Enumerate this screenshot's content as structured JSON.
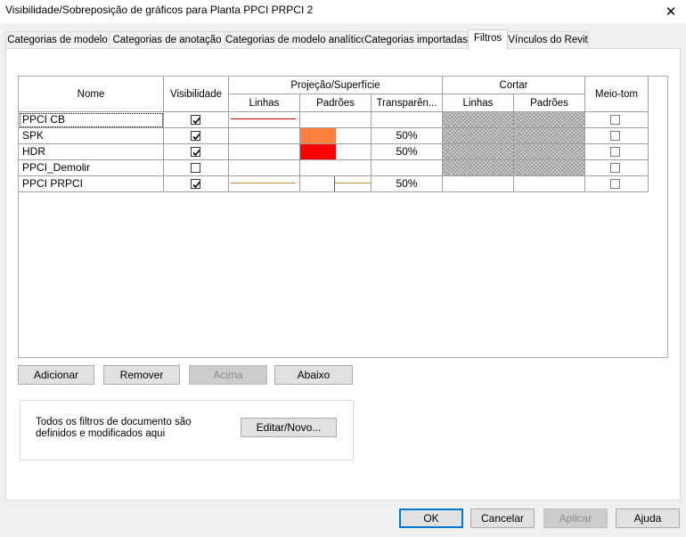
{
  "window": {
    "title": "Visibilidade/Sobreposição de gráficos para Planta PPCI PRPCI 2",
    "close_glyph": "✕"
  },
  "tabs": [
    {
      "label": "Categorias de modelo"
    },
    {
      "label": "Categorias de anotação"
    },
    {
      "label": "Categorias de modelo analítico"
    },
    {
      "label": "Categorias importadas"
    },
    {
      "label": "Filtros",
      "active": true
    },
    {
      "label": "Vínculos do Revit"
    }
  ],
  "table": {
    "headers": {
      "nome": "Nome",
      "visibilidade": "Visibilidade",
      "projecao_group": "Projeção/Superfície",
      "proj_linhas": "Linhas",
      "proj_padroes": "Padrões",
      "proj_transparencia": "Transparên...",
      "cortar_group": "Cortar",
      "cortar_linhas": "Linhas",
      "cortar_padroes": "Padrões",
      "meio_tom": "Meio-tom"
    },
    "rows": [
      {
        "name": "PPCI CB",
        "visible": true,
        "line_color": "#c00000",
        "pattern_color": null,
        "transparency": "",
        "halftone": false
      },
      {
        "name": "SPK",
        "visible": true,
        "line_color": null,
        "pattern_color": "#ff7f3f",
        "transparency": "50%",
        "halftone": false
      },
      {
        "name": "HDR",
        "visible": true,
        "line_color": null,
        "pattern_color": "#ff0000",
        "transparency": "50%",
        "halftone": false
      },
      {
        "name": "PPCI_Demolir",
        "visible": false,
        "line_color": null,
        "pattern_color": null,
        "transparency": "",
        "halftone": false
      },
      {
        "name": "PPCI PRPCI",
        "visible": true,
        "line_color": "#d08a2a",
        "pattern_color": "#d08a2a",
        "transparency": "50%",
        "halftone": false
      }
    ]
  },
  "buttons": {
    "adicionar": "Adicionar",
    "remover": "Remover",
    "acima": "Acima",
    "abaixo": "Abaixo",
    "editar": "Editar/Novo...",
    "ok": "OK",
    "cancelar": "Cancelar",
    "aplicar": "Aplicar",
    "ajuda": "Ajuda"
  },
  "info_text": "Todos os filtros de documento são definidos e modificados aqui"
}
